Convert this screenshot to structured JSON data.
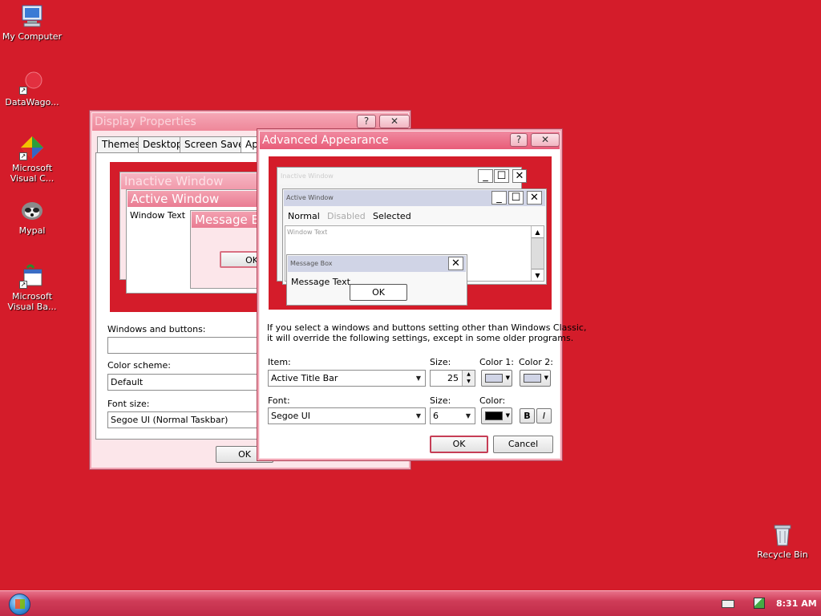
{
  "desktop": {
    "icons": [
      {
        "label": "My Computer",
        "icon": "computer-icon"
      },
      {
        "label": "DataWago...",
        "icon": "data-wagon-icon"
      },
      {
        "label": "Microsoft Visual C...",
        "icon": "visual-c-icon"
      },
      {
        "label": "Mypal",
        "icon": "mypal-icon"
      },
      {
        "label": "Microsoft Visual Ba...",
        "icon": "visual-basic-icon"
      },
      {
        "label": "Recycle Bin",
        "icon": "recycle-bin-icon"
      }
    ]
  },
  "display_properties": {
    "title": "Display Properties",
    "tabs": [
      "Themes",
      "Desktop",
      "Screen Saver",
      "Ap"
    ],
    "preview": {
      "inactive_title": "Inactive Window",
      "active_title": "Active Window",
      "window_text": "Window Text",
      "message_box_title": "Message Bo",
      "ok": "OK"
    },
    "windows_buttons_label": "Windows and buttons:",
    "windows_buttons_value": "",
    "color_scheme_label": "Color scheme:",
    "color_scheme_value": "Default",
    "font_size_label": "Font size:",
    "font_size_value": "Segoe UI (Normal Taskbar)",
    "ok": "OK"
  },
  "advanced_appearance": {
    "title": "Advanced Appearance",
    "preview": {
      "inactive_title": "Inactive Window",
      "active_title": "Active Window",
      "menu": [
        "Normal",
        "Disabled",
        "Selected"
      ],
      "window_text": "Window Text",
      "message_box_title": "Message Box",
      "message_text": "Message Text",
      "ok": "OK"
    },
    "info_line1": "If you select a windows and buttons setting other than Windows Classic,",
    "info_line2": "it will override the following settings, except in some older programs.",
    "item_label": "Item:",
    "item_value": "Active Title Bar",
    "size_label": "Size:",
    "item_size_value": "25",
    "color1_label": "Color 1:",
    "color2_label": "Color 2:",
    "font_label": "Font:",
    "font_value": "Segoe UI",
    "font_size_label": "Size:",
    "font_size_value": "6",
    "color_label": "Color:",
    "bold": "B",
    "italic": "I",
    "ok": "OK",
    "cancel": "Cancel"
  },
  "colors": {
    "desktop": "#d41c2a",
    "color1": "#d0d4e6",
    "color2": "#d0d4e6",
    "font_color": "#000000"
  },
  "taskbar": {
    "clock": "8:31 AM"
  }
}
